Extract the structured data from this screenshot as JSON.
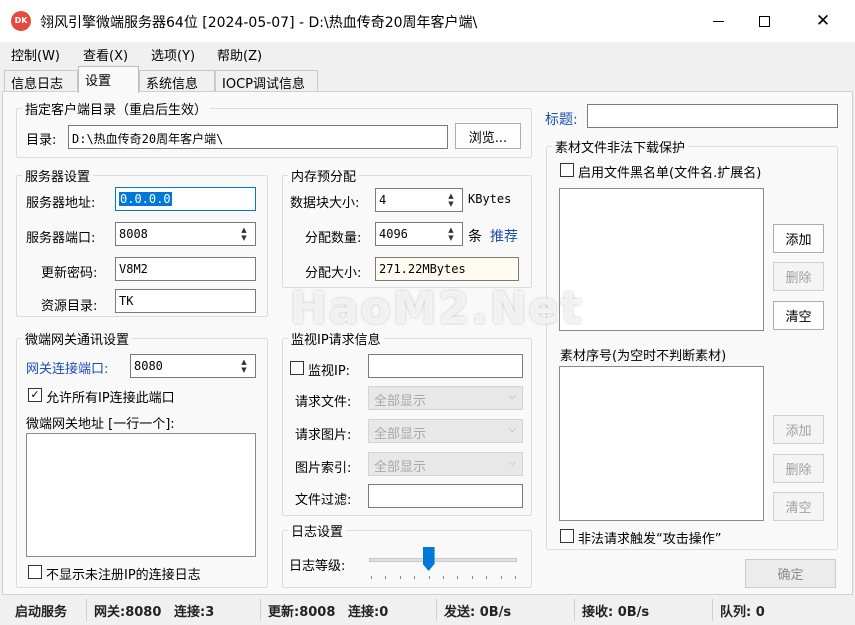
{
  "window": {
    "title": "翎风引擎微端服务器64位 [2024-05-07] - D:\\热血传奇20周年客户端\\",
    "icon_text": "DK",
    "minimize_icon": "minimize-icon",
    "maximize_icon": "maximize-icon",
    "close_icon": "close-icon"
  },
  "menu": [
    "控制(W)",
    "查看(X)",
    "选项(Y)",
    "帮助(Z)"
  ],
  "tabs": [
    "信息日志",
    "设置",
    "系统信息",
    "IOCP调试信息"
  ],
  "client_dir": {
    "group_title": "指定客户端目录（重启后生效）",
    "label": "目录:",
    "value": "D:\\热血传奇20周年客户端\\",
    "browse_label": "浏览..."
  },
  "server": {
    "group_title": "服务器设置",
    "address_label": "服务器地址:",
    "address_value": "0.0.0.0",
    "port_label": "服务器端口:",
    "port_value": "8008",
    "password_label": "更新密码:",
    "password_value": "V8M2",
    "resource_label": "资源目录:",
    "resource_value": "TK"
  },
  "memory": {
    "group_title": "内存预分配",
    "block_label": "数据块大小:",
    "block_value": "4",
    "block_unit": "KBytes",
    "count_label": "分配数量:",
    "count_value": "4096",
    "count_unit": "条",
    "recommend_label": "推荐",
    "size_label": "分配大小:",
    "size_value": "271.22MBytes"
  },
  "gateway": {
    "group_title": "微端网关通讯设置",
    "port_label": "网关连接端口:",
    "port_value": "8080",
    "allow_all_label": "允许所有IP连接此端口",
    "allow_all_checked": true,
    "address_label": "微端网关地址 [一行一个]:",
    "hide_log_label": "不显示未注册IP的连接日志",
    "hide_log_checked": false
  },
  "monitor": {
    "group_title": "监视IP请求信息",
    "ip_label": "监视IP:",
    "ip_checked": false,
    "request_file_label": "请求文件:",
    "request_image_label": "请求图片:",
    "image_index_label": "图片索引:",
    "combo_value": "全部显示",
    "file_filter_label": "文件过滤:"
  },
  "log": {
    "group_title": "日志设置",
    "level_label": "日志等级:",
    "level_fraction": 0.4
  },
  "protect": {
    "title_label": "标题:",
    "title_value": "",
    "group_title": "素材文件非法下载保护",
    "blacklist_label": "启用文件黑名单(文件名.扩展名)",
    "blacklist_checked": false,
    "add_label": "添加",
    "delete_label": "删除",
    "clear_label": "清空",
    "serial_label": "素材序号(为空时不判断素材)",
    "attack_label": "非法请求触发“攻击操作”",
    "attack_checked": false
  },
  "confirm_label": "确定",
  "watermark": "HaoM2.Net",
  "status": {
    "service": "启动服务",
    "gateway": "网关:8080",
    "gateway_conn": "连接:3",
    "update": "更新:8008",
    "update_conn": "连接:0",
    "send": "发送: 0B/s",
    "recv": "接收: 0B/s",
    "queue": "队列: 0"
  }
}
